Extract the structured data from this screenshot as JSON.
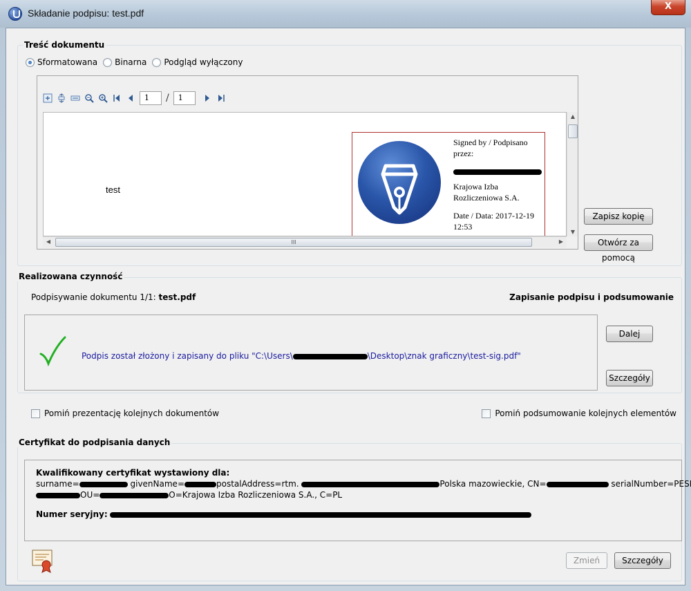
{
  "window": {
    "title": "Składanie podpisu: test.pdf",
    "close_label": "X"
  },
  "content": {
    "group_title": "Treść dokumentu",
    "radio": [
      "Sformatowana",
      "Binarna",
      "Podgląd wyłączony"
    ],
    "selected_radio": "Sformatowana",
    "page_current": "1",
    "page_total": "1",
    "doc_text": "test",
    "signature": {
      "line1": "Signed by / Podpisano przez:",
      "org": "Krajowa Izba Rozliczeniowa S.A.",
      "date": "Date / Data: 2017-12-19 12:53"
    },
    "scroll_grip": "III",
    "save_copy": "Zapisz kopię",
    "open_with": "Otwórz za pomocą"
  },
  "action": {
    "group_title": "Realizowana czynność",
    "progress_prefix": "Podpisywanie dokumentu 1/1: ",
    "progress_file": "test.pdf",
    "stage": "Zapisanie podpisu i podsumowanie",
    "msg_prefix": "Podpis został złożony i zapisany do pliku \"C:\\Users\\",
    "msg_suffix": "\\Desktop\\znak graficzny\\test-sig.pdf\"",
    "next": "Dalej",
    "details": "Szczegóły"
  },
  "options": {
    "skip_docs": "Pomiń prezentację kolejnych dokumentów",
    "skip_summary": "Pomiń podsumowanie kolejnych elementów"
  },
  "certificate": {
    "group_title": "Certyfikat do podpisania danych",
    "heading": "Kwalifikowany certyfikat wystawiony dla:",
    "line1_a": "surname=",
    "line1_b": "givenName=",
    "line1_c": "postalAddress=rtm.",
    "line1_d": "Polska mazowieckie, CN=",
    "line1_e": "serialNumber=PESEL:",
    "line2_a": "OU=",
    "line2_b": "O=Krajowa Izba Rozliczeniowa S.A., C=PL",
    "serial_label": "Numer seryjny:",
    "change": "Zmień",
    "details": "Szczegóły"
  }
}
